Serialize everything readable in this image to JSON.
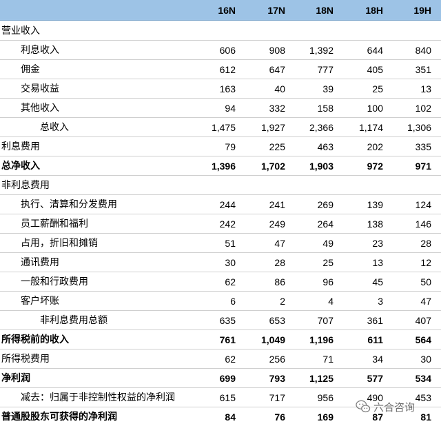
{
  "header": {
    "columns": [
      "16N",
      "17N",
      "18N",
      "18H",
      "19H"
    ]
  },
  "rows": [
    {
      "label": "营业收入",
      "indent": 0,
      "bold": false,
      "values": [
        "",
        "",
        "",
        "",
        ""
      ]
    },
    {
      "label": "利息收入",
      "indent": 1,
      "bold": false,
      "values": [
        "606",
        "908",
        "1,392",
        "644",
        "840"
      ]
    },
    {
      "label": "佣金",
      "indent": 1,
      "bold": false,
      "values": [
        "612",
        "647",
        "777",
        "405",
        "351"
      ]
    },
    {
      "label": "交易收益",
      "indent": 1,
      "bold": false,
      "values": [
        "163",
        "40",
        "39",
        "25",
        "13"
      ]
    },
    {
      "label": "其他收入",
      "indent": 1,
      "bold": false,
      "values": [
        "94",
        "332",
        "158",
        "100",
        "102"
      ]
    },
    {
      "label": "总收入",
      "indent": 2,
      "bold": false,
      "values": [
        "1,475",
        "1,927",
        "2,366",
        "1,174",
        "1,306"
      ]
    },
    {
      "label": "利息费用",
      "indent": 0,
      "bold": false,
      "values": [
        "79",
        "225",
        "463",
        "202",
        "335"
      ]
    },
    {
      "label": "总净收入",
      "indent": 0,
      "bold": true,
      "values": [
        "1,396",
        "1,702",
        "1,903",
        "972",
        "971"
      ]
    },
    {
      "label": "非利息费用",
      "indent": 0,
      "bold": false,
      "values": [
        "",
        "",
        "",
        "",
        ""
      ]
    },
    {
      "label": "执行、清算和分发费用",
      "indent": 1,
      "bold": false,
      "values": [
        "244",
        "241",
        "269",
        "139",
        "124"
      ]
    },
    {
      "label": "员工薪酬和福利",
      "indent": 1,
      "bold": false,
      "values": [
        "242",
        "249",
        "264",
        "138",
        "146"
      ]
    },
    {
      "label": "占用，折旧和摊销",
      "indent": 1,
      "bold": false,
      "values": [
        "51",
        "47",
        "49",
        "23",
        "28"
      ]
    },
    {
      "label": "通讯费用",
      "indent": 1,
      "bold": false,
      "values": [
        "30",
        "28",
        "25",
        "13",
        "12"
      ]
    },
    {
      "label": "一般和行政费用",
      "indent": 1,
      "bold": false,
      "values": [
        "62",
        "86",
        "96",
        "45",
        "50"
      ]
    },
    {
      "label": "客户坏账",
      "indent": 1,
      "bold": false,
      "values": [
        "6",
        "2",
        "4",
        "3",
        "47"
      ]
    },
    {
      "label": "非利息费用总额",
      "indent": 2,
      "bold": false,
      "values": [
        "635",
        "653",
        "707",
        "361",
        "407"
      ]
    },
    {
      "label": "所得税前的收入",
      "indent": 0,
      "bold": true,
      "values": [
        "761",
        "1,049",
        "1,196",
        "611",
        "564"
      ]
    },
    {
      "label": "所得税费用",
      "indent": 0,
      "bold": false,
      "values": [
        "62",
        "256",
        "71",
        "34",
        "30"
      ]
    },
    {
      "label": "净利润",
      "indent": 0,
      "bold": true,
      "values": [
        "699",
        "793",
        "1,125",
        "577",
        "534"
      ]
    },
    {
      "label": "减去：归属于非控制性权益的净利润",
      "indent": 1,
      "bold": false,
      "values": [
        "615",
        "717",
        "956",
        "490",
        "453"
      ]
    },
    {
      "label": "普通股股东可获得的净利润",
      "indent": 0,
      "bold": true,
      "values": [
        "84",
        "76",
        "169",
        "87",
        "81"
      ]
    }
  ],
  "watermark": {
    "text": "六合咨询",
    "icon": "wechat-icon"
  }
}
